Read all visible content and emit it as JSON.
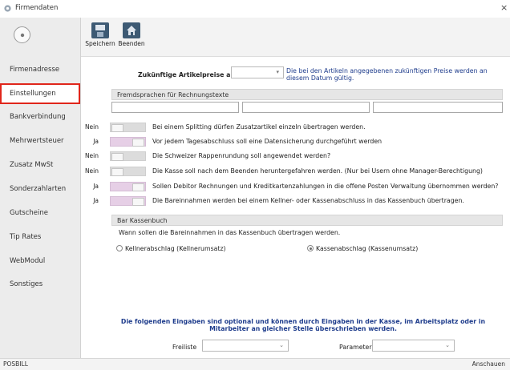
{
  "window": {
    "title": "Firmendaten",
    "close_glyph": "×",
    "app_icon": "gear-icon"
  },
  "sidebar": {
    "back_icon": "chevron-left-icon",
    "items": [
      {
        "label": "Firmenadresse",
        "active": false
      },
      {
        "label": "Einstellungen",
        "active": true
      },
      {
        "label": "Bankverbindung",
        "active": false
      },
      {
        "label": "Mehrwertsteuer",
        "active": false
      },
      {
        "label": "Zusatz MwSt",
        "active": false
      },
      {
        "label": "Sonderzahlarten",
        "active": false
      },
      {
        "label": "Gutscheine",
        "active": false
      },
      {
        "label": "Tip Rates",
        "active": false
      },
      {
        "label": "WebModul",
        "active": false
      },
      {
        "label": "Sonstiges",
        "active": false
      }
    ]
  },
  "toolbar": {
    "save_label": "Speichern",
    "save_icon": "save-icon",
    "quit_label": "Beenden",
    "quit_icon": "home-icon"
  },
  "future_prices": {
    "label": "Zukünftige Artikelpreise ab:",
    "value": "",
    "hint": "Die bei den Artikeln angegebenen zukünftigen Preise werden an diesem Datum gültig."
  },
  "foreign_lang": {
    "header": "Fremdsprachen für Rechnungstexte",
    "fields": [
      "",
      "",
      ""
    ]
  },
  "settings": [
    {
      "state": "Nein",
      "on": false,
      "text": "Bei einem Splitting dürfen Zusatzartikel einzeln übertragen werden."
    },
    {
      "state": "Ja",
      "on": true,
      "text": "Vor jedem Tagesabschluss soll eine Datensicherung durchgeführt werden"
    },
    {
      "state": "Nein",
      "on": false,
      "text": "Die Schweizer Rappenrundung soll angewendet werden?"
    },
    {
      "state": "Nein",
      "on": false,
      "text": "Die Kasse soll nach dem Beenden heruntergefahren werden. (Nur bei Usern ohne Manager-Berechtigung)"
    },
    {
      "state": "Ja",
      "on": true,
      "text": "Sollen Debitor Rechnungen und Kreditkartenzahlungen in die offene Posten Verwaltung übernommen werden?"
    },
    {
      "state": "Ja",
      "on": true,
      "text": "Die Bareinnahmen werden bei einem Kellner- oder Kassenabschluss in das Kassenbuch übertragen."
    }
  ],
  "kassenbuch": {
    "header": "Bar Kassenbuch",
    "question": "Wann sollen die Bareinnahmen in das Kassenbuch übertragen werden.",
    "option_1": "Kellnerabschlag (Kellnerumsatz)",
    "option_2": "Kassenabschlag (Kassenumsatz)",
    "selected": "option_2"
  },
  "optional_note": "Die folgenden Eingaben sind optional und können durch Eingaben in der Kasse, im Arbeitsplatz oder in Mitarbeiter an gleicher Stelle überschrieben werden.",
  "freiliste": {
    "label": "Freiliste",
    "value": ""
  },
  "parameter": {
    "label": "Parameter",
    "value": ""
  },
  "status": {
    "left": "POSBILL",
    "right": "Anschauen"
  },
  "colors": {
    "active_outline": "#e0261b",
    "toggle_on": "#e6cfe6",
    "toggle_off": "#dcdcdc",
    "blue_text": "#1e3c8c"
  }
}
